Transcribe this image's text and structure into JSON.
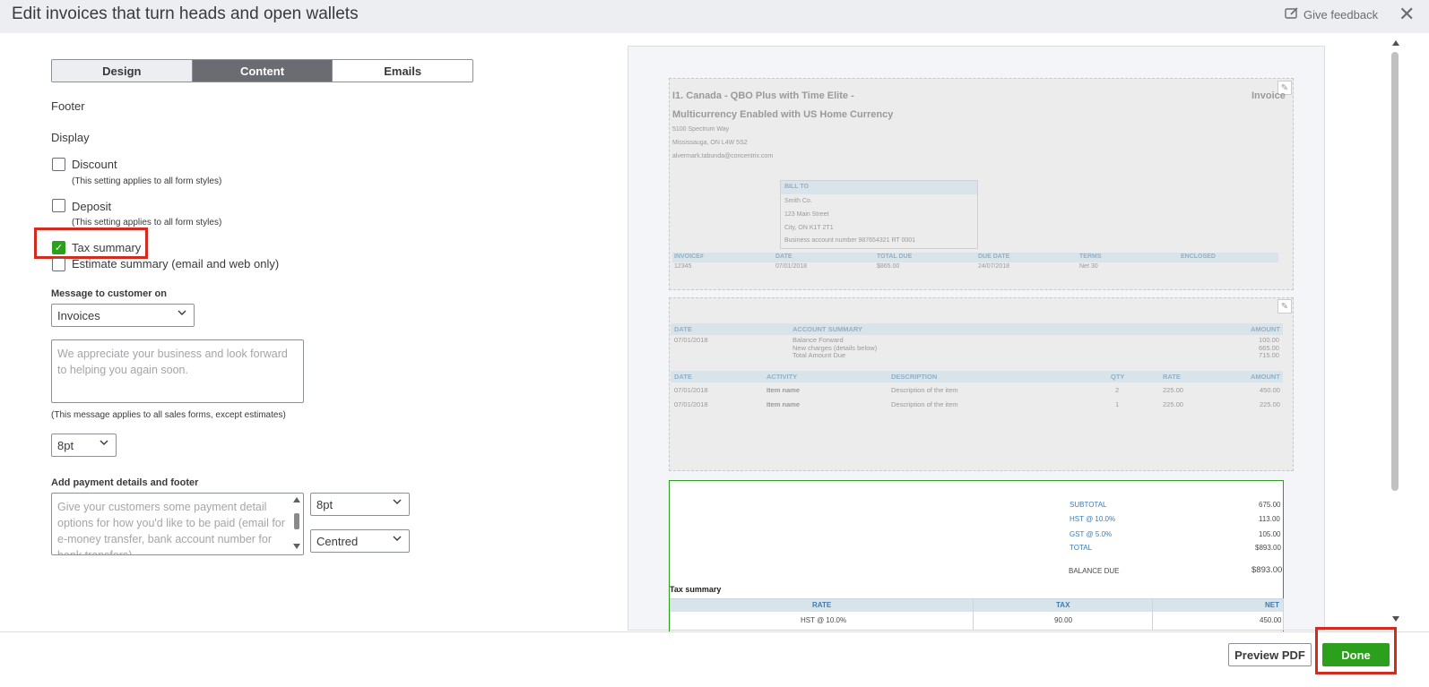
{
  "header": {
    "title": "Edit invoices that turn heads and open wallets",
    "feedback_label": "Give feedback",
    "close_symbol": "✕"
  },
  "tabs": [
    "Design",
    "Content",
    "Emails"
  ],
  "active_tab": "Content",
  "section_label": "Footer",
  "display": {
    "heading": "Display",
    "discount_label": "Discount",
    "discount_note": "(This setting applies to all form styles)",
    "deposit_label": "Deposit",
    "deposit_note": "(This setting applies to all form styles)",
    "tax_summary_label": "Tax summary",
    "tax_summary_checked": true,
    "estimate_summary_label": "Estimate summary (email and web only)"
  },
  "message": {
    "heading": "Message to customer on",
    "selected": "Invoices",
    "placeholder": "We appreciate your business and look forward to helping you again soon.",
    "note": "(This message applies to all sales forms, except estimates)",
    "font_size": "8pt"
  },
  "payment": {
    "heading": "Add payment details and footer",
    "placeholder": "Give your customers some payment detail options for how you'd like to be paid (email for e-money transfer, bank account number for bank transfers)",
    "font_size": "8pt",
    "alignment": "Centred"
  },
  "preview": {
    "company_line1": "I1. Canada - QBO Plus with Time Elite -",
    "company_line2": "Multicurrency Enabled with US Home Currency",
    "invoice_word": "Invoice",
    "address1": "5100 Spectrum Way",
    "address2": "Mississauga, ON L4W 5S2",
    "email": "alvermark.tabunda@concentrix.com",
    "bill_to": {
      "heading": "BILL TO",
      "lines": [
        "Smith Co.",
        "123 Main Street",
        "City, ON K1T 2T1",
        "Business account number  987654321 RT 0001"
      ]
    },
    "invoice_meta_headers": [
      "INVOICE#",
      "DATE",
      "TOTAL DUE",
      "DUE DATE",
      "TERMS",
      "ENCLOSED"
    ],
    "invoice_meta_values": [
      "12345",
      "07/01/2018",
      "$865.00",
      "24/07/2018",
      "Net 30",
      ""
    ],
    "account_headers": [
      "DATE",
      "ACCOUNT SUMMARY",
      "AMOUNT"
    ],
    "account_date": "07/01/2018",
    "account_lines": [
      "Balance Forward",
      "New charges (details below)",
      "Total Amount Due"
    ],
    "account_amounts": [
      "100.00",
      "665.00",
      "715.00"
    ],
    "item_headers": [
      "DATE",
      "ACTIVITY",
      "DESCRIPTION",
      "QTY",
      "RATE",
      "AMOUNT"
    ],
    "items": [
      [
        "07/01/2018",
        "Item name",
        "Description of the item",
        "2",
        "225.00",
        "450.00"
      ],
      [
        "07/01/2018",
        "Item name",
        "Description of the item",
        "1",
        "225.00",
        "225.00"
      ]
    ],
    "totals": [
      [
        "SUBTOTAL",
        "675.00"
      ],
      [
        "HST @ 10.0%",
        "113.00"
      ],
      [
        "GST @ 5.0%",
        "105.00"
      ],
      [
        "TOTAL",
        "$893.00"
      ]
    ],
    "balance_due_label": "BALANCE DUE",
    "balance_due_value": "$893.00",
    "tax_summary_title": "Tax summary",
    "tax_headers": [
      "RATE",
      "TAX",
      "NET"
    ],
    "tax_row": [
      "HST @ 10.0%",
      "90.00",
      "450.00"
    ]
  },
  "footer_buttons": {
    "preview": "Preview PDF",
    "done": "Done"
  },
  "colors": {
    "accent_green": "#2ca01c",
    "highlight_red": "#d52b1e"
  }
}
